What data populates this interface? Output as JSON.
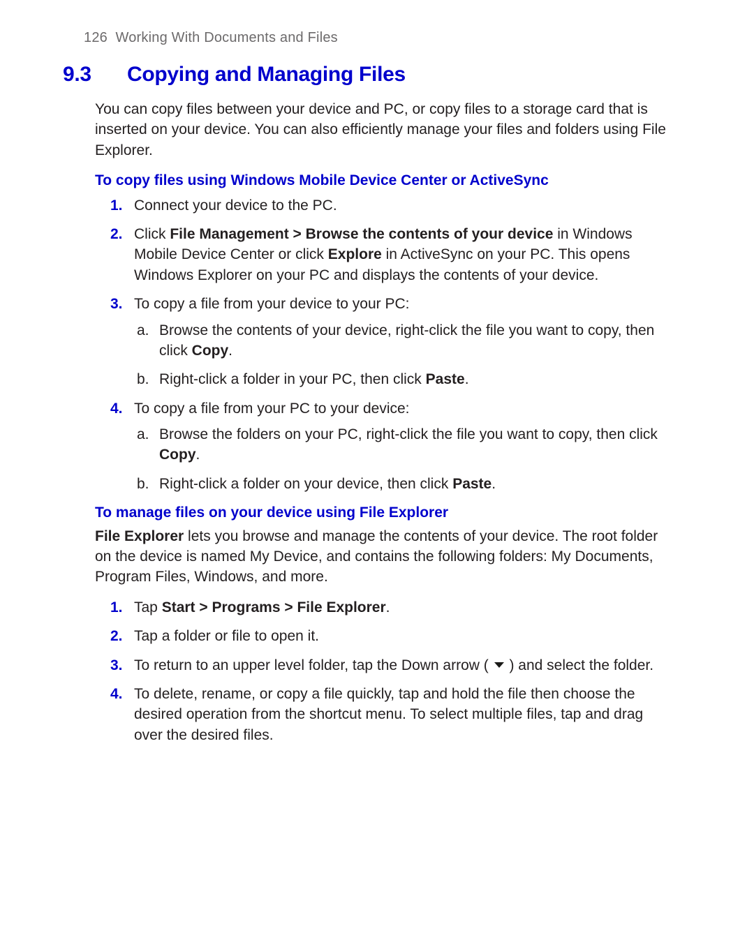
{
  "running_head": {
    "page_no": "126",
    "chapter": "Working With Documents and Files"
  },
  "section": {
    "number": "9.3",
    "title": "Copying and Managing Files"
  },
  "intro": "You can copy files between your device and PC, or copy files to a storage card that is inserted on your device. You can also efficiently manage your files and folders using File Explorer.",
  "sub1": {
    "heading": "To copy files using Windows Mobile Device Center or ActiveSync",
    "items": {
      "m1": "1.",
      "t1": "Connect your device to the PC.",
      "m2": "2.",
      "t2a": "Click ",
      "t2b": "File Management > Browse the contents of your device",
      "t2c": " in Windows Mobile Device Center or click ",
      "t2d": "Explore",
      "t2e": " in ActiveSync on your PC. This opens Windows Explorer on your PC and displays the contents of your device.",
      "m3": "3.",
      "t3": "To copy a file from your device to your PC:",
      "m3a": "a.",
      "t3a_a": "Browse the contents of your device, right-click the file you want to copy, then click ",
      "t3a_b": "Copy",
      "t3a_c": ".",
      "m3b": "b.",
      "t3b_a": "Right-click a folder in your PC, then click ",
      "t3b_b": "Paste",
      "t3b_c": ".",
      "m4": "4.",
      "t4": "To copy a file from your PC to your device:",
      "m4a": "a.",
      "t4a_a": "Browse the folders on your PC, right-click the file you want to copy, then click ",
      "t4a_b": "Copy",
      "t4a_c": ".",
      "m4b": "b.",
      "t4b_a": "Right-click a folder on your device, then click ",
      "t4b_b": "Paste",
      "t4b_c": "."
    }
  },
  "sub2": {
    "heading": "To manage files on your device using File Explorer",
    "para_a": "File Explorer",
    "para_b": " lets you browse and manage the contents of your device. The root folder on the device is named My Device, and contains the following folders: My Documents, Program Files, Windows, and more.",
    "items": {
      "m1": "1.",
      "t1a": "Tap ",
      "t1b": "Start > Programs > File Explorer",
      "t1c": ".",
      "m2": "2.",
      "t2": "Tap a folder or file to open it.",
      "m3": "3.",
      "t3a": "To return to an upper level folder, tap the Down arrow ( ",
      "t3b": " ) and select the folder.",
      "m4": "4.",
      "t4": "To delete, rename, or copy a file quickly, tap and hold the file then choose the desired operation from the shortcut menu. To select multiple files, tap and drag over the desired files."
    }
  }
}
